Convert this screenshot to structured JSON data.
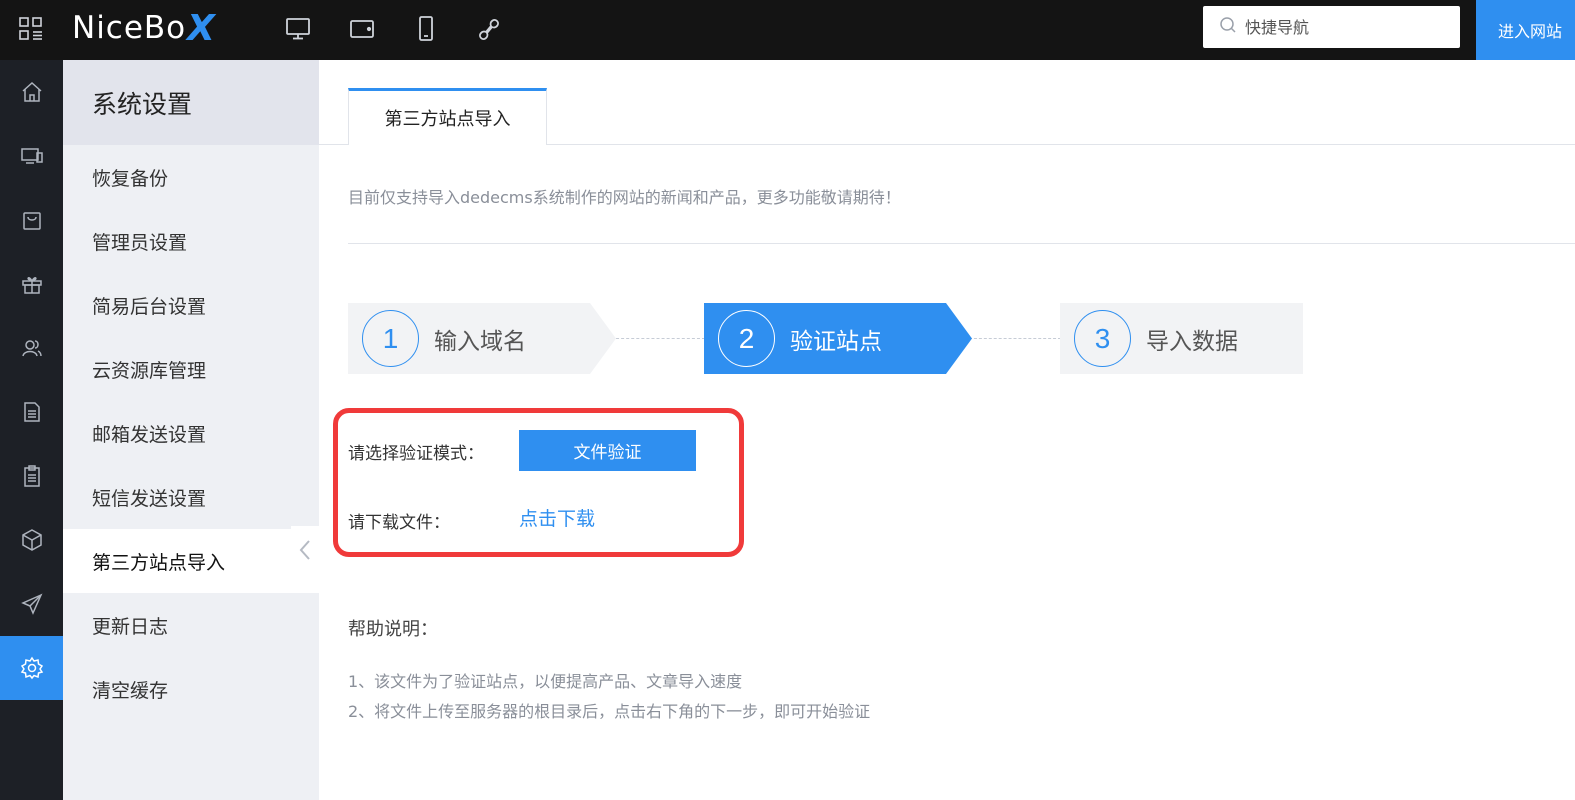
{
  "header": {
    "logo_text": "NiceBo",
    "logo_x": "X",
    "search_placeholder": "快捷导航",
    "enter_site_label": "进入网站",
    "accent_color": "#2f8ff0",
    "device_icons": [
      "desktop-icon",
      "tablet-icon",
      "mobile-icon",
      "link-icon"
    ]
  },
  "iconbar": {
    "items": [
      "home-icon",
      "devices-icon",
      "bag-icon",
      "gift-icon",
      "users-icon",
      "document-icon",
      "clipboard-icon",
      "cube-icon",
      "send-icon",
      "settings-icon"
    ],
    "active": "settings-icon"
  },
  "sidebar": {
    "title": "系统设置",
    "items": [
      {
        "label": "恢复备份"
      },
      {
        "label": "管理员设置"
      },
      {
        "label": "简易后台设置"
      },
      {
        "label": "云资源库管理"
      },
      {
        "label": "邮箱发送设置"
      },
      {
        "label": "短信发送设置"
      },
      {
        "label": "第三方站点导入"
      },
      {
        "label": "更新日志"
      },
      {
        "label": "清空缓存"
      }
    ],
    "active_item": "第三方站点导入"
  },
  "main": {
    "tab_label": "第三方站点导入",
    "notice": "目前仅支持导入dedecms系统制作的网站的新闻和产品，更多功能敬请期待！",
    "steps": [
      {
        "number": "1",
        "label": "输入域名"
      },
      {
        "number": "2",
        "label": "验证站点"
      },
      {
        "number": "3",
        "label": "导入数据"
      }
    ],
    "active_step": "2",
    "verify_mode_label": "请选择验证模式：",
    "verify_button": "文件验证",
    "download_label": "请下载文件：",
    "download_link": "点击下载",
    "help_title": "帮助说明：",
    "help_lines": [
      "1、该文件为了验证站点，以便提高产品、文章导入速度",
      "2、将文件上传至服务器的根目录后，点击右下角的下一步，即可开始验证"
    ]
  }
}
